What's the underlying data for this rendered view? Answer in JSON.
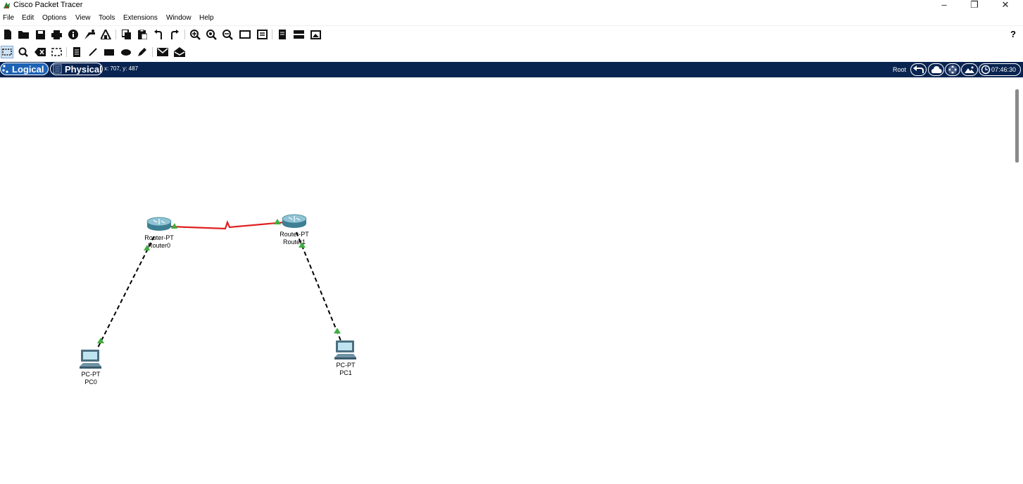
{
  "window": {
    "title": "Cisco Packet Tracer",
    "minimize_glyph": "–",
    "restore_glyph": "❐",
    "close_glyph": "✕"
  },
  "menu": [
    "File",
    "Edit",
    "Options",
    "View",
    "Tools",
    "Extensions",
    "Window",
    "Help"
  ],
  "toolbar": {
    "help_label": "?"
  },
  "workspace_bar": {
    "logical_label": "Logical",
    "physical_label": "Physical",
    "coordinates": "x: 707, y: 487",
    "root_label": "Root",
    "time": "07:46:30"
  },
  "devices": [
    {
      "id": "router0",
      "model": "Router-PT",
      "name": "Router0",
      "type": "router"
    },
    {
      "id": "router1",
      "model": "Router-PT",
      "name": "Router1",
      "type": "router"
    },
    {
      "id": "pc0",
      "model": "PC-PT",
      "name": "PC0",
      "type": "pc"
    },
    {
      "id": "pc1",
      "model": "PC-PT",
      "name": "PC1",
      "type": "pc"
    }
  ],
  "links": [
    {
      "from": "Router0",
      "to": "Router1",
      "kind": "serial",
      "color": "#e02020"
    },
    {
      "from": "Router0",
      "to": "PC0",
      "kind": "copper-crossover",
      "color": "#000000"
    },
    {
      "from": "Router1",
      "to": "PC1",
      "kind": "copper-crossover",
      "color": "#000000"
    }
  ],
  "colors": {
    "navbar": "#0a2451",
    "logical_tab": "#1d63b6",
    "link_up": "#3fae3f",
    "serial_link": "#e02020"
  }
}
